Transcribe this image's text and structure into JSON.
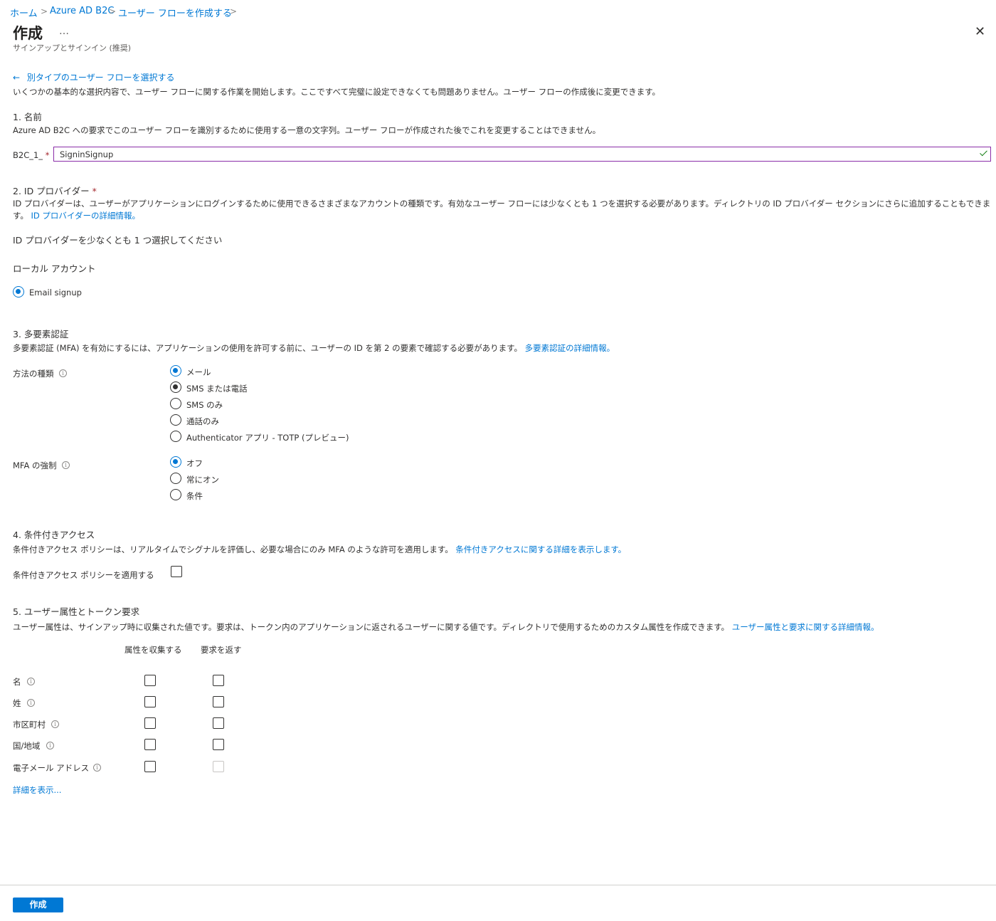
{
  "breadcrumb": {
    "items": [
      "ホーム",
      "Azure AD B2C",
      "ユーザー フローを作成する"
    ]
  },
  "header": {
    "title": "作成",
    "ellipsis": "…",
    "subtitle": "サインアップとサインイン (推奨)",
    "close_icon": "close-icon"
  },
  "back_link": {
    "arrow": "←",
    "label": "別タイプのユーザー フローを選択する"
  },
  "intro": "いくつかの基本的な選択内容で、ユーザー フローに関する作業を開始します。ここですべて完璧に設定できなくても問題ありません。ユーザー フローの作成後に変更できます。",
  "section1": {
    "heading": "1. 名前",
    "description": "Azure AD B2C への要求でこのユーザー フローを識別するために使用する一意の文字列。ユーザー フローが作成された後でこれを変更することはできません。",
    "prefix_label": "B2C_1_",
    "required_mark": "*",
    "name_value": "SigninSignup"
  },
  "section2": {
    "heading": "2. ID プロバイダー",
    "required_mark": "*",
    "description_line1": "ID プロバイダーは、ユーザーがアプリケーションにログインするために使用できるさまざまなアカウントの種類です。有効なユーザー フローには少なくとも 1 つを選択する必要があります。ディレクトリの ID プロバイダー セクションにさらに追加することもできま",
    "description_line2": "す。",
    "learn_more": "ID プロバイダーの詳細情報。",
    "notice": "ID プロバイダーを少なくとも 1 つ選択してください",
    "local_account_label": "ローカル アカウント",
    "email_signup_label": "Email signup",
    "email_signup_selected": true
  },
  "section3": {
    "heading": "3. 多要素認証",
    "description": "多要素認証 (MFA) を有効にするには、アプリケーションの使用を許可する前に、ユーザーの ID を第 2 の要素で確認する必要があります。",
    "learn_more": "多要素認証の詳細情報。",
    "method_label": "方法の種類",
    "method_options": [
      "メール",
      "SMS または電話",
      "SMS のみ",
      "通話のみ",
      "Authenticator アプリ - TOTP (プレビュー)"
    ],
    "enforce_label": "MFA の強制",
    "enforce_options": [
      "オフ",
      "常にオン",
      "条件"
    ]
  },
  "section4": {
    "heading": "4. 条件付きアクセス",
    "description": "条件付きアクセス ポリシーは、リアルタイムでシグナルを評価し、必要な場合にのみ MFA のような許可を適用します。",
    "learn_more": "条件付きアクセスに関する詳細を表示します。",
    "apply_label": "条件付きアクセス ポリシーを適用する",
    "apply_checked": false
  },
  "section5": {
    "heading": "5. ユーザー属性とトークン要求",
    "description": "ユーザー属性は、サインアップ時に収集された値です。要求は、トークン内のアプリケーションに返されるユーザーに関する値です。ディレクトリで使用するためのカスタム属性を作成できます。",
    "learn_more": "ユーザー属性と要求に関する詳細情報。",
    "col_collect": "属性を収集する",
    "col_return": "要求を返す",
    "rows": [
      "名",
      "姓",
      "市区町村",
      "国/地域",
      "電子メール アドレス"
    ],
    "show_more": "詳細を表示..."
  },
  "footer": {
    "create_button": "作成"
  },
  "colors": {
    "accent": "#0078d4",
    "required": "#a4262c",
    "valid": "#107c10",
    "input_border": "#8a2da8"
  }
}
